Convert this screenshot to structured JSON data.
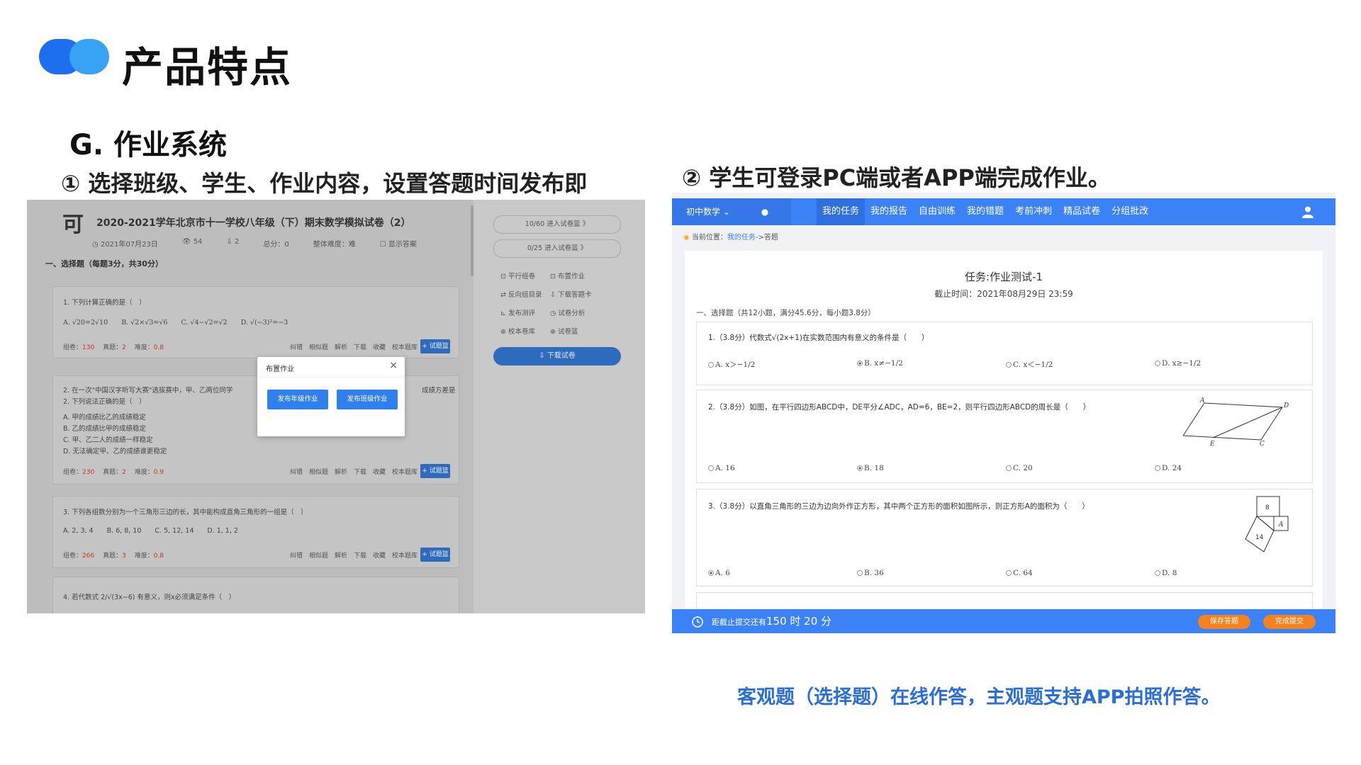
{
  "header": {
    "title": "产品特点",
    "brand_colors": [
      "#1e6ff0",
      "#38a3f5"
    ]
  },
  "section": {
    "title": "G. 作业系统",
    "step1": "① 选择班级、学生、作业内容，设置答题时间发布即",
    "step2": "② 学生可登录PC端或者APP端完成作业。",
    "caption": "客观题（选择题）在线作答，主观题支持APP拍照作答。"
  },
  "teacher_view": {
    "big_char": "可",
    "paper_title": "2020-2021学年北京市十一学校八年级（下）期末数学模拟试卷（2）",
    "meta": [
      "2021年07月23日",
      "54",
      "2",
      "总分：0",
      "整体难度：难",
      "显示答案"
    ],
    "section_head": "一、选择题（每题3分，共30分）",
    "questions": [
      {
        "text": "1. 下列计算正确的是（　）",
        "options": "A. √20=2√10　　B. √2×√3=√6　　C. √4−√2=√2　　D. √(−3)²=−3",
        "assembled": "130",
        "real": "2",
        "difficulty": "0.8"
      },
      {
        "text": "2. 在一次\"中国汉字听写大赛\"选拔赛中，甲、乙两位同学",
        "text2": "2. 下列说法正确的是（　）",
        "options_list": [
          "A. 甲的成绩比乙的成绩稳定",
          "B. 乙的成绩比甲的成绩稳定",
          "C. 甲、乙二人的成绩一样稳定",
          "D. 无法确定甲、乙的成绩谁更稳定"
        ],
        "tail": "成绩方差是",
        "assembled": "230",
        "real": "2",
        "difficulty": "0.9"
      },
      {
        "text": "3. 下列各组数分别为一个三角形三边的长，其中能构成直角三角形的一组是（　）",
        "options": "A. 2, 3, 4　　B. 6, 8, 10　　C. 5, 12, 14　　D. 1, 1, 2",
        "assembled": "266",
        "real": "3",
        "difficulty": "0.8"
      },
      {
        "text": "4. 若代数式 2/√(3x−6) 有意义，则x必须满足条件（　）"
      }
    ],
    "footer_labels": {
      "assembled": "组卷：",
      "real": "真题：",
      "difficulty": "难度："
    },
    "tools": "纠错　相似题　解析　下载　收藏　校本题库",
    "add_label": "+ 试题篮",
    "side": {
      "pill1": "10/60 进入试卷篮 》",
      "pill2": "0/25 进入试卷篮 》",
      "links": [
        "平行组卷",
        "布置作业",
        "反向组目录",
        "下载答题卡",
        "发布测评",
        "试卷分析",
        "校本卷库",
        "试卷篮"
      ],
      "download": "下载试卷"
    },
    "modal": {
      "title": "布置作业",
      "close": "×",
      "btn1": "发布年级作业",
      "btn2": "发布班级作业"
    }
  },
  "student_view": {
    "subject": "初中数学 ⌄",
    "nav": [
      "我的任务",
      "我的报告",
      "自由训练",
      "我的错题",
      "考前冲刺",
      "精品试卷",
      "分组批改"
    ],
    "active_nav": "我的任务",
    "crumb_prefix": "当前位置：",
    "crumb_link": "我的任务",
    "crumb_suffix": "->答题",
    "exam_title": "任务:作业测试-1",
    "deadline": "截止时间：2021年08月29日 23:59",
    "section": "一、选择题（共12小题，满分45.6分，每小题3.8分）",
    "questions": [
      {
        "text": "1.（3.8分）代数式√(2x+1)在实数范围内有意义的条件是（　　）",
        "options": [
          "A. x＞−1/2",
          "B. x≠−1/2",
          "C. x＜−1/2",
          "D. x≥−1/2"
        ],
        "selected": 1
      },
      {
        "text": "2.（3.8分）如图，在平行四边形ABCD中，DE平分∠ADC，AD=6，BE=2，则平行四边形ABCD的周长是（　　）",
        "options": [
          "A. 16",
          "B. 18",
          "C. 20",
          "D. 24"
        ],
        "selected": 1,
        "fig_labels": [
          "A",
          "D",
          "B",
          "E",
          "C"
        ]
      },
      {
        "text": "3.（3.8分）以直角三角形的三边为边向外作正方形，其中两个正方形的面积如图所示，则正方形A的面积为（　　）",
        "options": [
          "A. 6",
          "B. 36",
          "C. 64",
          "D. 8"
        ],
        "selected": 0,
        "fig_labels": [
          "8",
          "A",
          "14"
        ]
      }
    ],
    "timer_prefix": "距截止提交还有",
    "timer_value": "150 时 20 分",
    "save_btn": "保存答题",
    "submit_btn": "完成提交"
  }
}
